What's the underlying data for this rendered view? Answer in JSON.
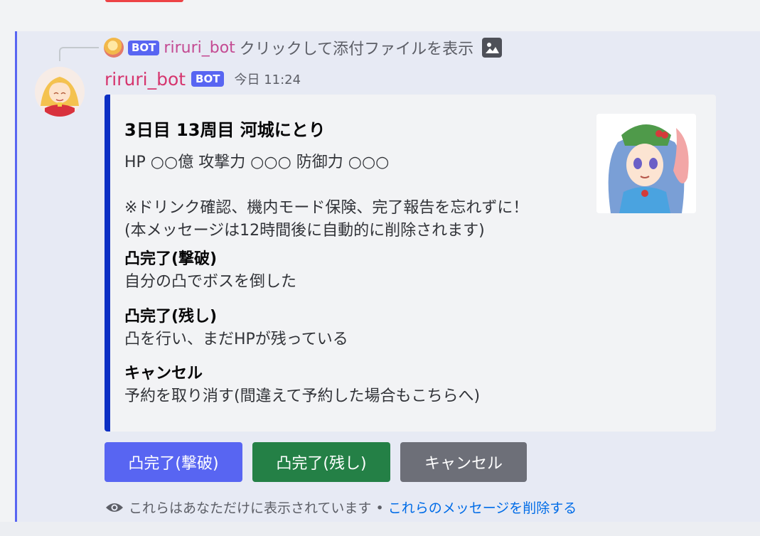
{
  "reply": {
    "bot_tag": "BOT",
    "username": "riruri_bot",
    "text": "クリックして添付ファイルを表示",
    "icon": "image-icon"
  },
  "message": {
    "username": "riruri_bot",
    "bot_tag": "BOT",
    "timestamp": "今日 11:24"
  },
  "embed": {
    "accent_color": "#0c2fc4",
    "title": "3日目 13周目 河城にとり",
    "description_line1": "HP ○○億 攻撃力 ○○○ 防御力 ○○○",
    "description_line2": "※ドリンク確認、機内モード保険、完了報告を忘れずに！",
    "description_line3": "(本メッセージは12時間後に自動的に削除されます)",
    "fields": [
      {
        "name": "凸完了(撃破)",
        "value": "自分の凸でボスを倒した"
      },
      {
        "name": "凸完了(残し)",
        "value": "凸を行い、まだHPが残っている"
      },
      {
        "name": "キャンセル",
        "value": "予約を取り消す(間違えて予約した場合もこちらへ)"
      }
    ]
  },
  "buttons": {
    "primary": "凸完了(撃破)",
    "success": "凸完了(残し)",
    "secondary": "キャンセル"
  },
  "ephemeral": {
    "icon": "eye-icon",
    "text": "これらはあなただけに表示されています •",
    "link": "これらのメッセージを削除する"
  },
  "colors": {
    "mention_bar": "#5865f2",
    "username": "#d6356e",
    "primary_button": "#5865f2",
    "success_button": "#248046",
    "secondary_button": "#6d6f78"
  }
}
